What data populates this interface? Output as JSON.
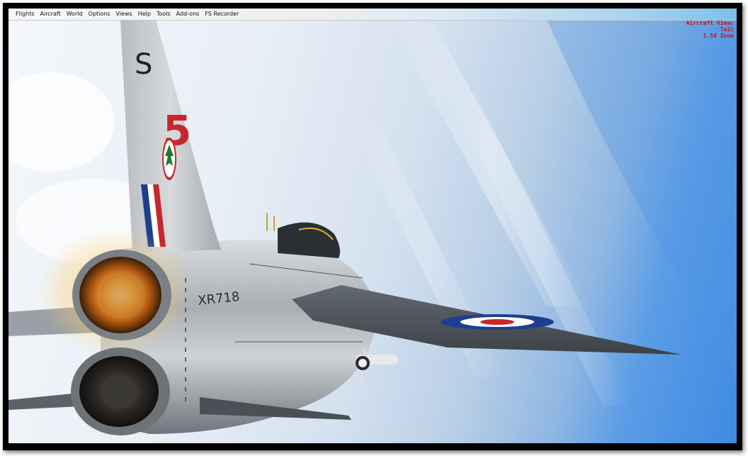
{
  "menu": {
    "items": [
      {
        "label": "Flights"
      },
      {
        "label": "Aircraft"
      },
      {
        "label": "World"
      },
      {
        "label": "Options"
      },
      {
        "label": "Views"
      },
      {
        "label": "Help"
      },
      {
        "label": "Tools"
      },
      {
        "label": "Add-ons"
      },
      {
        "label": "FS Recorder"
      }
    ]
  },
  "hud": {
    "line1": "Aircraft View:",
    "line2": "Tail",
    "line3": "1.50 Zoom",
    "color": "#c4141a"
  },
  "aircraft": {
    "fin_letter": "S",
    "fin_number": "5",
    "serial": "XR718"
  }
}
